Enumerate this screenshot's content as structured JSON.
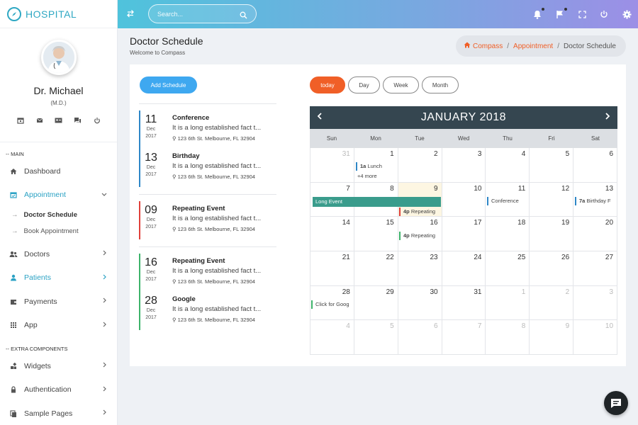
{
  "brand": {
    "name": "HOSPITAL"
  },
  "profile": {
    "name": "Dr. Michael",
    "role": "(M.D.)"
  },
  "nav": {
    "main_label": "-- MAIN",
    "dashboard": "Dashboard",
    "appointment": "Appointment",
    "doctor_schedule": "Doctor Schedule",
    "book_appointment": "Book Appointment",
    "doctors": "Doctors",
    "patients": "Patients",
    "payments": "Payments",
    "app": "App",
    "extra_label": "-- EXTRA COMPONENTS",
    "widgets": "Widgets",
    "authentication": "Authentication",
    "sample_pages": "Sample Pages"
  },
  "search": {
    "placeholder": "Search..."
  },
  "header": {
    "title": "Doctor Schedule",
    "subtitle": "Welcome to Compass"
  },
  "breadcrumb": {
    "home": "Compass",
    "parent": "Appointment",
    "current": "Doctor Schedule"
  },
  "add_button": "Add Schedule",
  "events": [
    {
      "day": "11",
      "month": "Dec",
      "year": "2017",
      "title": "Conference",
      "desc": "It is a long established fact t...",
      "address": "123 6th St. Melbourne, FL 32904"
    },
    {
      "day": "13",
      "month": "Dec",
      "year": "2017",
      "title": "Birthday",
      "desc": "It is a long established fact t...",
      "address": "123 6th St. Melbourne, FL 32904"
    },
    {
      "day": "09",
      "month": "Dec",
      "year": "2017",
      "title": "Repeating Event",
      "desc": "It is a long established fact t...",
      "address": "123 6th St. Melbourne, FL 32904"
    },
    {
      "day": "16",
      "month": "Dec",
      "year": "2017",
      "title": "Repeating Event",
      "desc": "It is a long established fact t...",
      "address": "123 6th St. Melbourne, FL 32904"
    },
    {
      "day": "28",
      "month": "Dec",
      "year": "2017",
      "title": "Google",
      "desc": "It is a long established fact t...",
      "address": "123 6th St. Melbourne, FL 32904"
    }
  ],
  "view_buttons": {
    "today": "today",
    "day": "Day",
    "week": "Week",
    "month": "Month"
  },
  "calendar": {
    "month_title": "JANUARY 2018",
    "weekdays": [
      "Sun",
      "Mon",
      "Tue",
      "Wed",
      "Thu",
      "Fri",
      "Sat"
    ],
    "weeks": [
      [
        "31",
        "1",
        "2",
        "3",
        "4",
        "5",
        "6"
      ],
      [
        "7",
        "8",
        "9",
        "10",
        "11",
        "12",
        "13"
      ],
      [
        "14",
        "15",
        "16",
        "17",
        "18",
        "19",
        "20"
      ],
      [
        "21",
        "22",
        "23",
        "24",
        "25",
        "26",
        "27"
      ],
      [
        "28",
        "29",
        "30",
        "31",
        "1",
        "2",
        "3"
      ],
      [
        "4",
        "5",
        "6",
        "7",
        "8",
        "9",
        "10"
      ]
    ],
    "cal_events": {
      "lunch_time": "1a",
      "lunch": "Lunch",
      "more": "+4 more",
      "long_event": "Long Event",
      "rep1_time": "4p",
      "rep1": "Repeating",
      "conference": "Conference",
      "bday_time": "7a",
      "bday": "Birthday F",
      "rep2_time": "4p",
      "rep2": "Repeating",
      "google": "Click for Goog"
    }
  },
  "colors": {
    "accent": "#2fa8c3",
    "orange": "#f05f27",
    "blue_btn": "#3ea8f0",
    "cal_header": "#354650",
    "long_event": "#3a9c8c",
    "red": "#e0403a",
    "green": "#3db36a",
    "blue_bar": "#2e87c7"
  }
}
